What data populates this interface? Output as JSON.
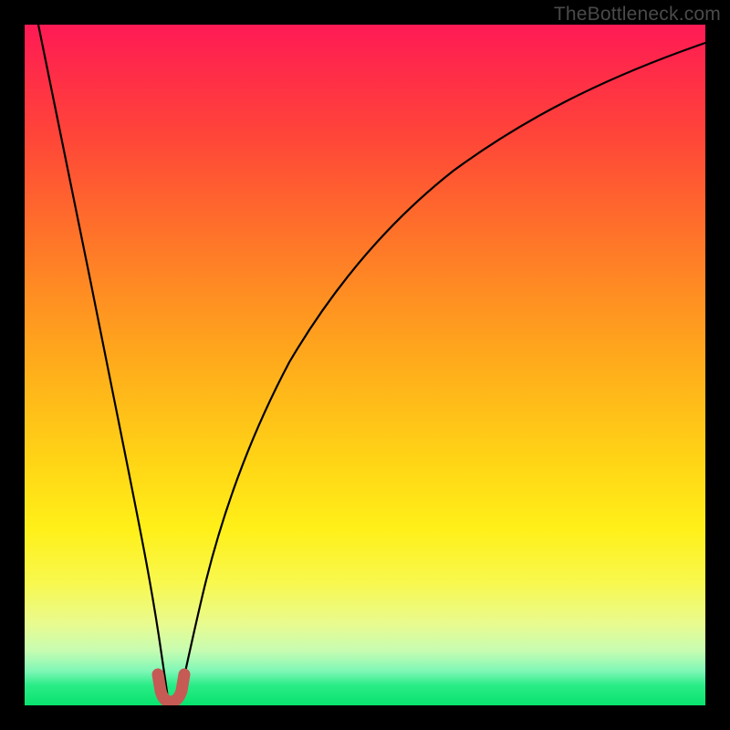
{
  "watermark": "TheBottleneck.com",
  "chart_data": {
    "type": "line",
    "title": "",
    "xlabel": "",
    "ylabel": "",
    "xlim": [
      0,
      100
    ],
    "ylim": [
      0,
      100
    ],
    "grid": false,
    "legend": false,
    "series": [
      {
        "name": "bottleneck-curve",
        "x": [
          2,
          4,
          6,
          8,
          10,
          12,
          14,
          16,
          18,
          19,
          20,
          21,
          22,
          23,
          24,
          26,
          28,
          30,
          34,
          38,
          44,
          50,
          58,
          66,
          74,
          82,
          90,
          100
        ],
        "y": [
          100,
          88,
          76,
          65,
          54,
          43,
          32,
          22,
          12,
          7,
          3,
          1,
          2,
          6,
          12,
          22,
          30,
          37,
          48,
          56,
          65,
          72,
          78,
          83,
          87,
          90,
          92,
          95
        ]
      }
    ],
    "marker": {
      "name": "optimal-point",
      "x_range": [
        19.5,
        22.5
      ],
      "y_range": [
        0,
        4
      ],
      "color": "#c65a54"
    },
    "background_gradient": {
      "top_color": "#ff1a55",
      "bottom_color": "#09e36e"
    }
  }
}
